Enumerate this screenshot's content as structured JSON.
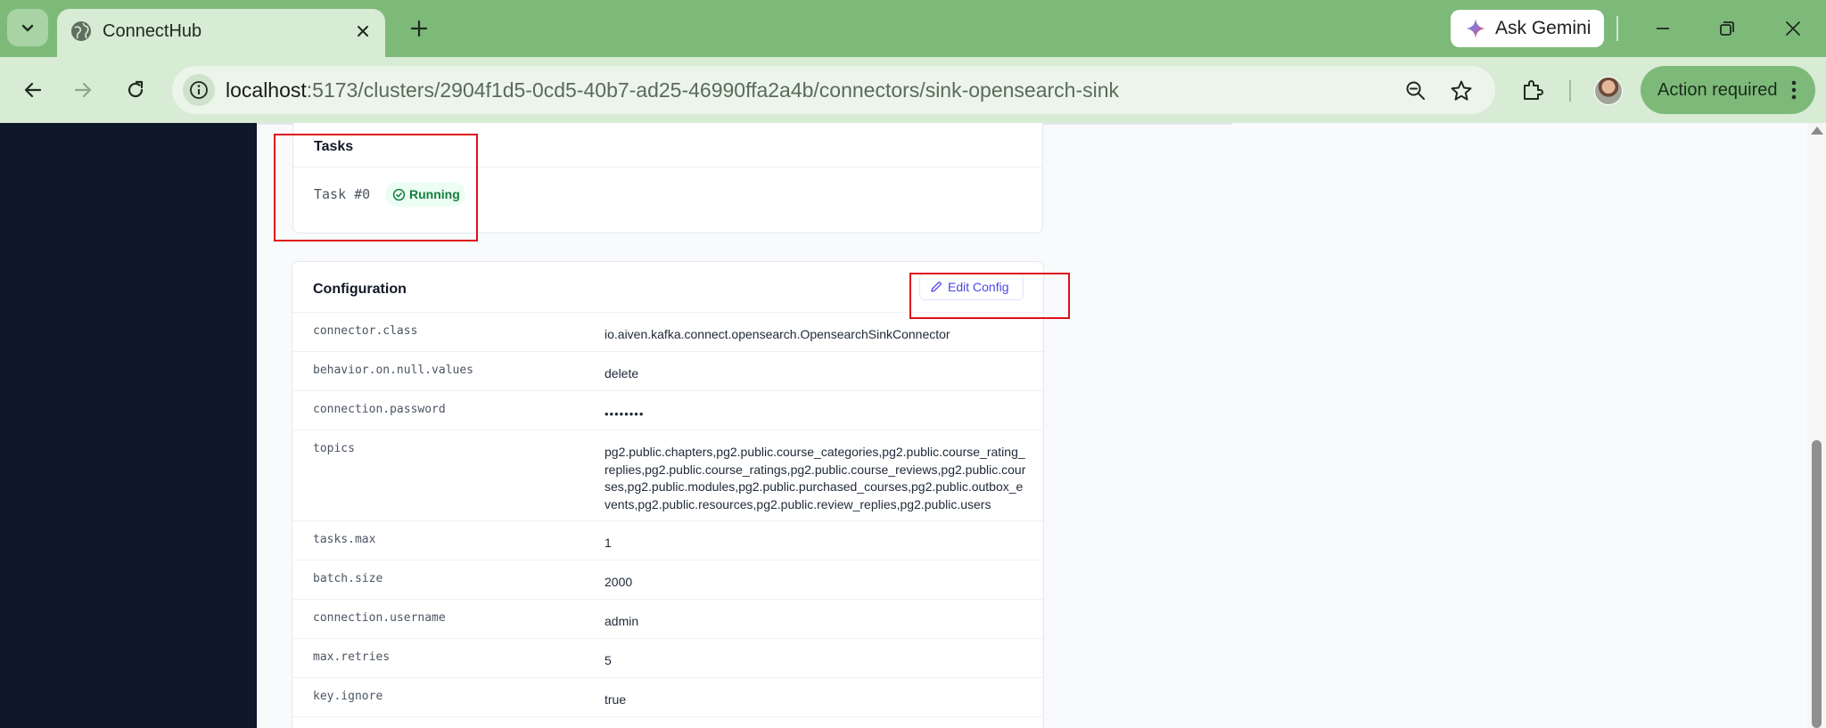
{
  "browser": {
    "tab_title": "ConnectHub",
    "url_host": "localhost",
    "url_path": ":5173/clusters/2904f1d5-0cd5-40b7-ad25-46990ffa2a4b/connectors/sink-opensearch-sink",
    "gemini_label": "Ask Gemini",
    "action_required_label": "Action required",
    "icons": [
      "chevron-down-icon",
      "globe-icon",
      "close-icon",
      "plus-icon",
      "gemini-sparkle-icon",
      "minimize-icon",
      "restore-icon",
      "close-window-icon",
      "back-icon",
      "forward-icon",
      "reload-icon",
      "site-info-icon",
      "zoom-icon",
      "star-icon",
      "extensions-icon",
      "more-vert-icon"
    ]
  },
  "tasks": {
    "title": "Tasks",
    "items": [
      {
        "name": "Task #0",
        "status": "Running"
      }
    ]
  },
  "configuration": {
    "title": "Configuration",
    "edit_label": "Edit Config",
    "rows": [
      {
        "key": "connector.class",
        "value": "io.aiven.kafka.connect.opensearch.OpensearchSinkConnector"
      },
      {
        "key": "behavior.on.null.values",
        "value": "delete"
      },
      {
        "key": "connection.password",
        "value": "••••••••"
      },
      {
        "key": "topics",
        "value": "pg2.public.chapters,pg2.public.course_categories,pg2.public.course_rating_replies,pg2.public.course_ratings,pg2.public.course_reviews,pg2.public.courses,pg2.public.modules,pg2.public.purchased_courses,pg2.public.outbox_events,pg2.public.resources,pg2.public.review_replies,pg2.public.users"
      },
      {
        "key": "tasks.max",
        "value": "1"
      },
      {
        "key": "batch.size",
        "value": "2000"
      },
      {
        "key": "connection.username",
        "value": "admin"
      },
      {
        "key": "max.retries",
        "value": "5"
      },
      {
        "key": "key.ignore",
        "value": "true"
      }
    ]
  },
  "colors": {
    "chrome_green": "#7dba7a",
    "sidebar": "#0f172a",
    "running_green": "#15803d",
    "accent_indigo": "#4f46e5",
    "annotation_red": "#e0101a"
  }
}
